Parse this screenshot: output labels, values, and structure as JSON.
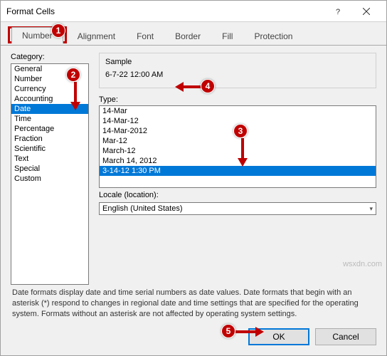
{
  "window": {
    "title": "Format Cells"
  },
  "tabs": [
    "Number",
    "Alignment",
    "Font",
    "Border",
    "Fill",
    "Protection"
  ],
  "activeTab": "Number",
  "category": {
    "label": "Category:",
    "items": [
      "General",
      "Number",
      "Currency",
      "Accounting",
      "Date",
      "Time",
      "Percentage",
      "Fraction",
      "Scientific",
      "Text",
      "Special",
      "Custom"
    ],
    "selected": "Date"
  },
  "sample": {
    "label": "Sample",
    "value": "6-7-22 12:00 AM"
  },
  "type": {
    "label": "Type:",
    "items": [
      "14-Mar",
      "14-Mar-12",
      "14-Mar-2012",
      "Mar-12",
      "March-12",
      "March 14, 2012",
      "3-14-12 1:30 PM"
    ],
    "selected": "3-14-12 1:30 PM"
  },
  "locale": {
    "label": "Locale (location):",
    "value": "English (United States)"
  },
  "description": "Date formats display date and time serial numbers as date values.  Date formats that begin with an asterisk (*) respond to changes in regional date and time settings that are specified for the operating system. Formats without an asterisk are not affected by operating system settings.",
  "buttons": {
    "ok": "OK",
    "cancel": "Cancel"
  },
  "callouts": {
    "c1": "1",
    "c2": "2",
    "c3": "3",
    "c4": "4",
    "c5": "5"
  },
  "watermark": "wsxdn.com"
}
